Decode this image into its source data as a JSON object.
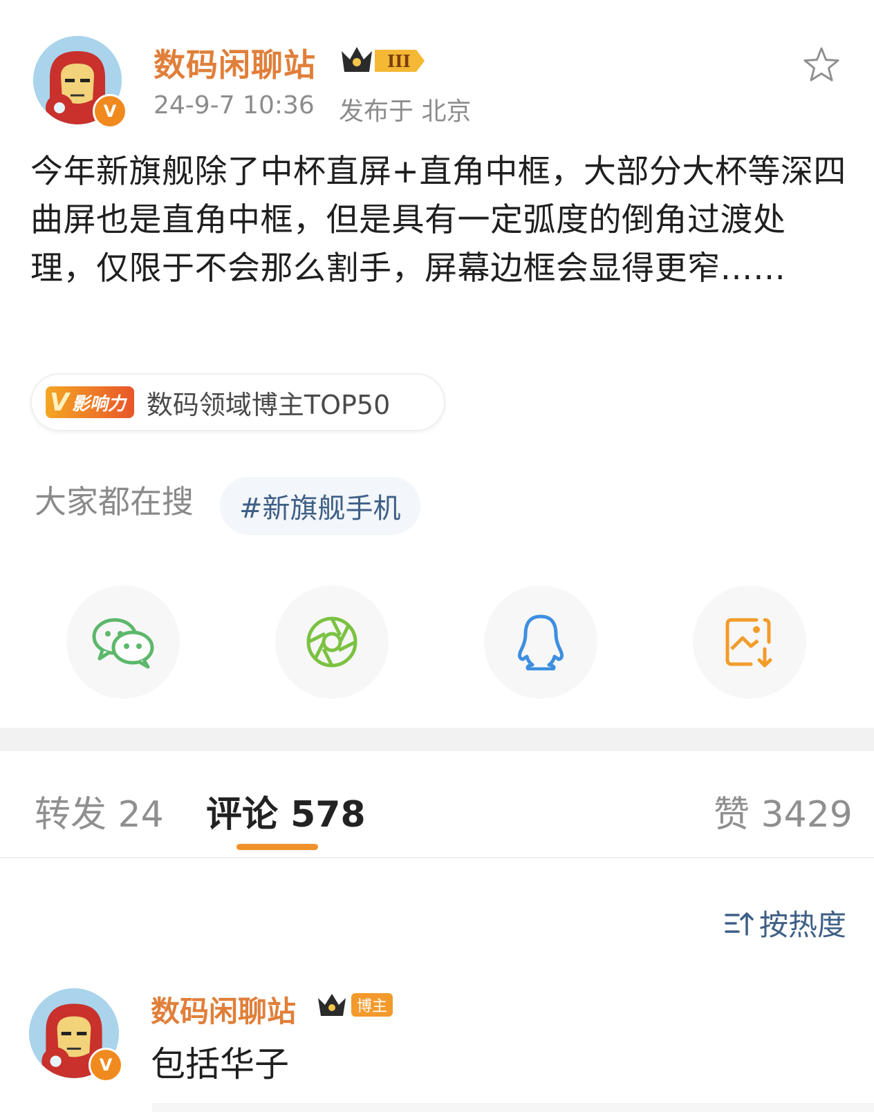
{
  "post": {
    "author": "数码闲聊站",
    "rank_badge": "III",
    "timestamp": "24-9-7 10:36",
    "location": "发布于 北京",
    "content": "今年新旗舰除了中杯直屏+直角中框，大部分大杯等深四曲屏也是直角中框，但是具有一定弧度的倒角过渡处理，仅限于不会那么割手，屏幕边框会显得更窄……",
    "influence_badge": "影响力",
    "influence_text": "数码领域博主TOP50",
    "search_label": "大家都在搜",
    "hashtag": "#新旗舰手机"
  },
  "share": {
    "icons": [
      "wechat-icon",
      "moments-icon",
      "qq-icon",
      "save-image-icon"
    ],
    "colors": {
      "wechat": "#5cb86a",
      "moments": "#7bc242",
      "qq": "#3d8fe0",
      "save": "#f29c2a"
    }
  },
  "tabs": {
    "repost_label": "转发 24",
    "comment_label": "评论 578",
    "like_label": "赞 3429"
  },
  "sort": {
    "label": "按热度"
  },
  "comment": {
    "author": "数码闲聊站",
    "tag": "博主",
    "text": "包括华子"
  },
  "colors": {
    "accent": "#f0922b",
    "username": "#e07f3a",
    "link": "#3e5f86"
  }
}
